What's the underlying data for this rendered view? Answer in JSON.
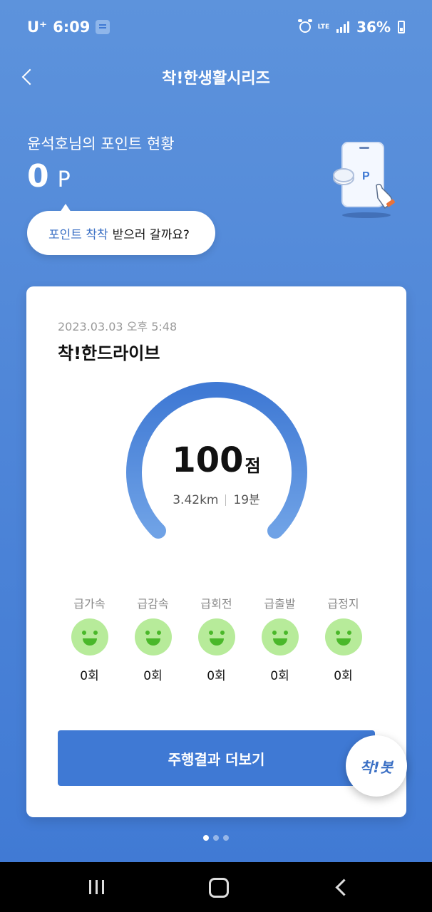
{
  "status_bar": {
    "carrier": "U⁺",
    "time": "6:09",
    "network": "LTE",
    "battery": "36%"
  },
  "header": {
    "title": "착!한생활시리즈"
  },
  "points": {
    "title": "윤석호님의 포인트 현황",
    "value": "0",
    "unit": "P",
    "bubble_highlight": "포인트 착착",
    "bubble_text": "받으러 갈까요?"
  },
  "card": {
    "date": "2023.03.03 오후 5:48",
    "title": "착!한드라이브",
    "score": "100",
    "score_unit": "점",
    "score_value": 100,
    "score_max": 100,
    "distance": "3.42km",
    "duration": "19분",
    "events": [
      {
        "label": "급가속",
        "count": "0회"
      },
      {
        "label": "급감속",
        "count": "0회"
      },
      {
        "label": "급회전",
        "count": "0회"
      },
      {
        "label": "급출발",
        "count": "0회"
      },
      {
        "label": "급정지",
        "count": "0회"
      }
    ],
    "more_button": "주행결과 더보기"
  },
  "fab": {
    "label": "착!봇"
  },
  "pager": {
    "total": 3,
    "active": 1
  },
  "colors": {
    "accent": "#3f79d4",
    "highlight_text": "#3a6fc4",
    "smiley_bg": "#b7eb9a",
    "smiley_face": "#4ab82a"
  },
  "icons": {
    "back": "chevron-left-icon",
    "illustration": "phone-points-icon",
    "smiley": "smiley-icon"
  }
}
